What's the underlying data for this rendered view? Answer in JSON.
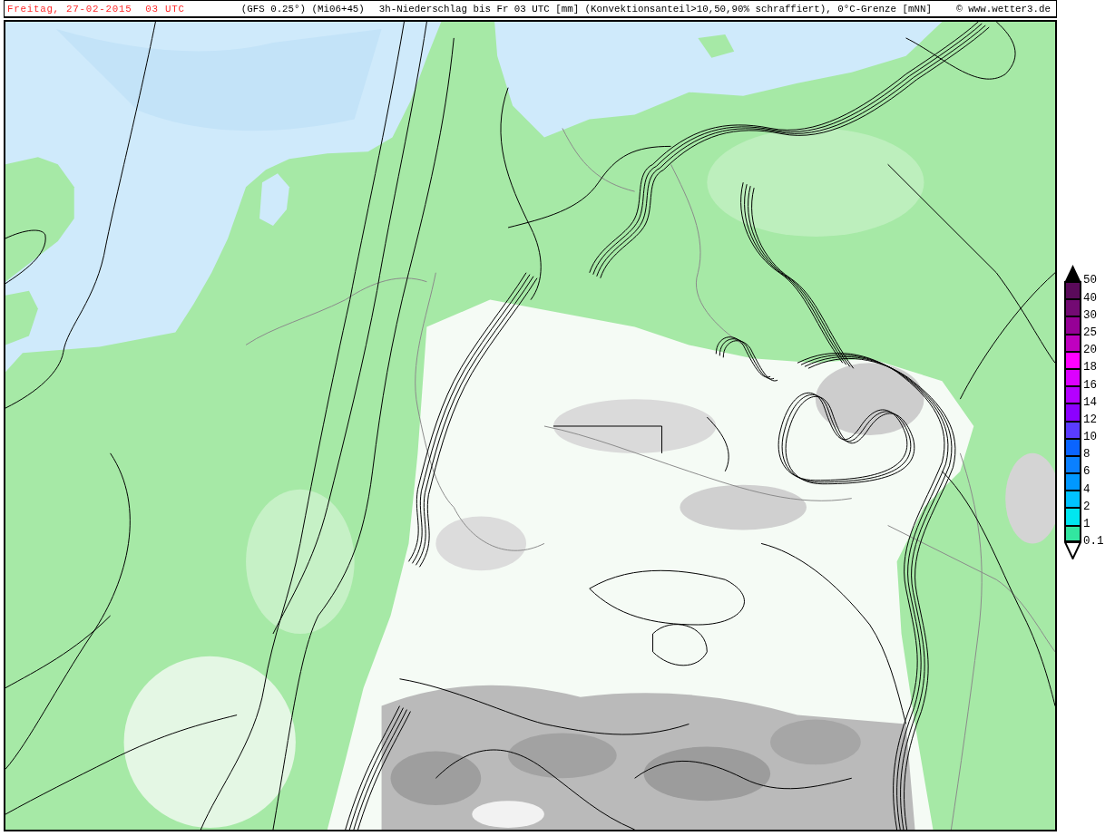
{
  "header": {
    "date": "Freitag, 27-02-2015",
    "time": "03 UTC",
    "model": "(GFS 0.25°) (Mi06+45)",
    "title": "3h-Niederschlag bis Fr 03 UTC [mm] (Konvektionsanteil>10,50,90% schraffiert), 0°C-Grenze [mNN]",
    "copyright": "© www.wetter3.de"
  },
  "legend": {
    "labels": [
      "50",
      "40",
      "30",
      "25",
      "20",
      "18",
      "16",
      "14",
      "12",
      "10",
      "8",
      "6",
      "4",
      "2",
      "1",
      "0.1"
    ],
    "bands": [
      {
        "color": "#5a0a5a"
      },
      {
        "color": "#730a73"
      },
      {
        "color": "#960096"
      },
      {
        "color": "#c000c0"
      },
      {
        "color": "#ff00ff"
      },
      {
        "color": "#dc00ff"
      },
      {
        "color": "#b400ff"
      },
      {
        "color": "#8c00ff"
      },
      {
        "color": "#5a3cff"
      },
      {
        "color": "#0a64ff"
      },
      {
        "color": "#0a80ff"
      },
      {
        "color": "#0098ff"
      },
      {
        "color": "#00c3ff"
      },
      {
        "color": "#00e6f0"
      },
      {
        "color": "#32e6a0"
      }
    ]
  }
}
